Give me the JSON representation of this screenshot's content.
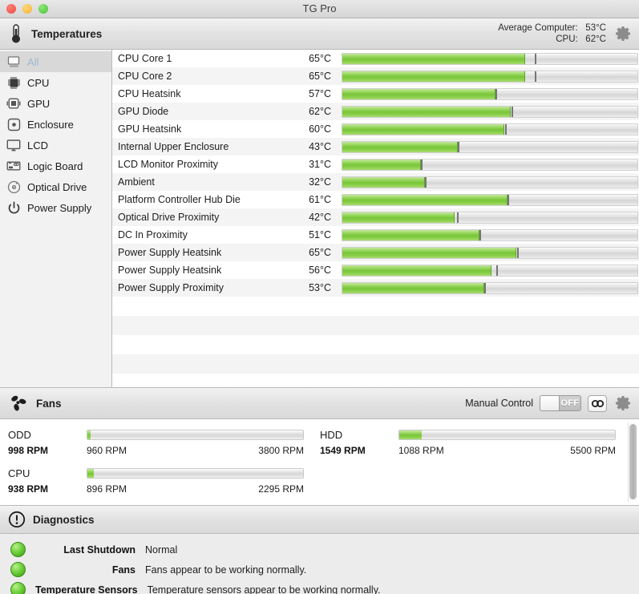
{
  "window": {
    "title": "TG Pro",
    "traffic_lights": [
      "close-button",
      "minimize-button",
      "zoom-button"
    ]
  },
  "temperatures_section": {
    "icon": "thermometer-icon",
    "title": "Temperatures",
    "stats": {
      "average_label": "Average Computer:",
      "average_value": "53°C",
      "cpu_label": "CPU:",
      "cpu_value": "62°C"
    },
    "settings_icon": "gear-icon"
  },
  "sidebar": {
    "items": [
      {
        "label": "All",
        "icon": "computer-icon",
        "selected": true
      },
      {
        "label": "CPU",
        "icon": "cpu-chip-icon",
        "selected": false
      },
      {
        "label": "GPU",
        "icon": "gpu-chip-icon",
        "selected": false
      },
      {
        "label": "Enclosure",
        "icon": "enclosure-icon",
        "selected": false
      },
      {
        "label": "LCD",
        "icon": "display-icon",
        "selected": false
      },
      {
        "label": "Logic Board",
        "icon": "logic-board-icon",
        "selected": false
      },
      {
        "label": "Optical Drive",
        "icon": "optical-disc-icon",
        "selected": false
      },
      {
        "label": "Power Supply",
        "icon": "power-icon",
        "selected": false
      }
    ]
  },
  "temperature_table": {
    "rows": [
      {
        "name": "CPU Core 1",
        "value": "65°C",
        "fill_pct": 62.0,
        "peak_pct": 65.5
      },
      {
        "name": "CPU Core 2",
        "value": "65°C",
        "fill_pct": 62.0,
        "peak_pct": 65.5
      },
      {
        "name": "CPU Heatsink",
        "value": "57°C",
        "fill_pct": 52.0,
        "peak_pct": 52.3
      },
      {
        "name": "GPU Diode",
        "value": "62°C",
        "fill_pct": 57.0,
        "peak_pct": 57.5
      },
      {
        "name": "GPU Heatsink",
        "value": "60°C",
        "fill_pct": 55.0,
        "peak_pct": 55.3
      },
      {
        "name": "Internal Upper Enclosure",
        "value": "43°C",
        "fill_pct": 39.0,
        "peak_pct": 39.3
      },
      {
        "name": "LCD Monitor Proximity",
        "value": "31°C",
        "fill_pct": 26.5,
        "peak_pct": 26.8
      },
      {
        "name": "Ambient",
        "value": "32°C",
        "fill_pct": 28.0,
        "peak_pct": 28.3
      },
      {
        "name": "Platform Controller Hub Die",
        "value": "61°C",
        "fill_pct": 56.0,
        "peak_pct": 56.3
      },
      {
        "name": "Optical Drive Proximity",
        "value": "42°C",
        "fill_pct": 38.0,
        "peak_pct": 39.2
      },
      {
        "name": "DC In Proximity",
        "value": "51°C",
        "fill_pct": 46.5,
        "peak_pct": 46.8
      },
      {
        "name": "Power Supply Heatsink",
        "value": "65°C",
        "fill_pct": 59.0,
        "peak_pct": 59.5
      },
      {
        "name": "Power Supply Heatsink",
        "value": "56°C",
        "fill_pct": 50.5,
        "peak_pct": 52.5
      },
      {
        "name": "Power Supply Proximity",
        "value": "53°C",
        "fill_pct": 48.0,
        "peak_pct": 48.4
      }
    ],
    "empty_rows": 4
  },
  "fans_section": {
    "icon": "fan-icon",
    "title": "Fans",
    "manual_control_label": "Manual Control",
    "manual_control_state": "OFF",
    "link_icon": "chain-link-icon",
    "settings_icon": "gear-icon",
    "fans": [
      {
        "name": "ODD",
        "current": "998 RPM",
        "min": "960 RPM",
        "max": "3800 RPM",
        "fill_pct": 1.4
      },
      {
        "name": "HDD",
        "current": "1549 RPM",
        "min": "1088 RPM",
        "max": "5500 RPM",
        "fill_pct": 10.4
      },
      {
        "name": "CPU",
        "current": "938 RPM",
        "min": "896 RPM",
        "max": "2295 RPM",
        "fill_pct": 3.0
      }
    ]
  },
  "diagnostics_section": {
    "icon": "exclamation-circle-icon",
    "title": "Diagnostics",
    "rows": [
      {
        "status": "green",
        "label": "Last Shutdown",
        "text": "Normal"
      },
      {
        "status": "green",
        "label": "Fans",
        "text": "Fans appear to be working normally."
      },
      {
        "status": "green",
        "label": "Temperature Sensors",
        "text": "Temperature sensors appear to be working normally."
      }
    ]
  },
  "colors": {
    "accent_green": "#79c63a",
    "window_bg": "#ececec",
    "selected_row": "#d8d8d8"
  }
}
